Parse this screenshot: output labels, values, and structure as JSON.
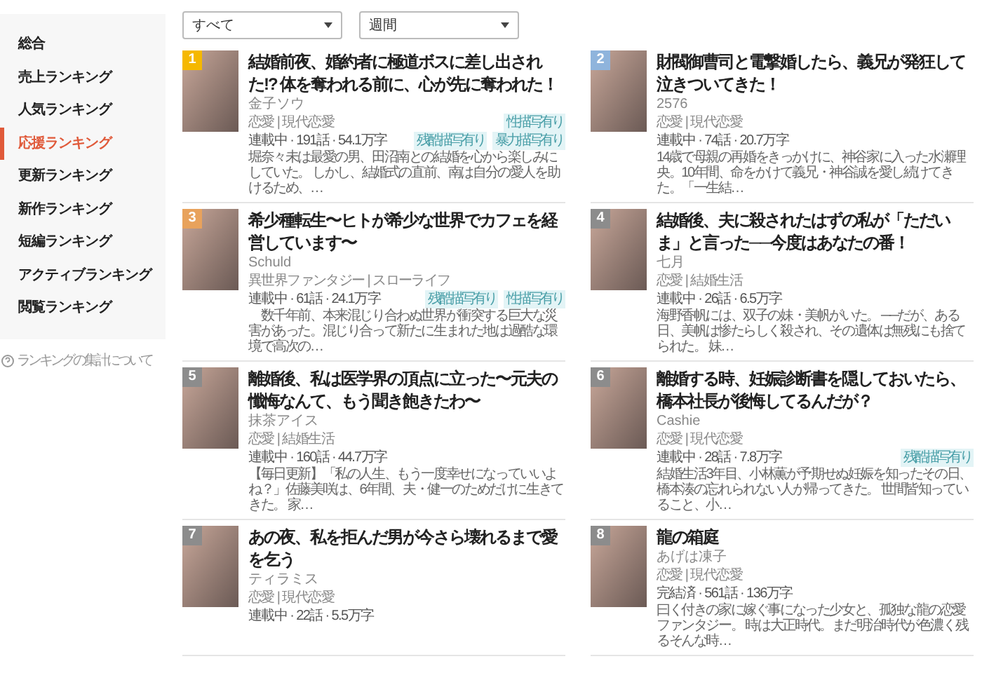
{
  "sidebar": {
    "items": [
      {
        "label": "総合",
        "selected": false
      },
      {
        "label": "売上ランキング",
        "selected": false
      },
      {
        "label": "人気ランキング",
        "selected": false
      },
      {
        "label": "応援ランキング",
        "selected": true
      },
      {
        "label": "更新ランキング",
        "selected": false
      },
      {
        "label": "新作ランキング",
        "selected": false
      },
      {
        "label": "短編ランキング",
        "selected": false
      },
      {
        "label": "アクティブランキング",
        "selected": false
      },
      {
        "label": "閲覧ランキング",
        "selected": false
      }
    ],
    "footer_link": "ランキングの集計について"
  },
  "filters": [
    {
      "value": "すべて"
    },
    {
      "value": "週間"
    }
  ],
  "books": [
    {
      "rank": "1",
      "color": "#f5b800",
      "title": "結婚前夜、婚約者に極道ボスに差し出された!? 体を奪われる前に、心が先に奪われた！",
      "author": "金子ソウ",
      "genre": "恋愛 | 現代恋愛",
      "genre_tags": [
        "性描写有り"
      ],
      "stats": "連載中 · 191話 · 54.1万字",
      "stats_tags": [
        "残酷描写有り",
        "暴力描写有り"
      ],
      "description": "堀奈々未は最愛の男、田沼南との結婚を心から楽しみにしていた。 しかし、結婚式の直前、南は自分の愛人を助けるため、…"
    },
    {
      "rank": "2",
      "color": "#8fb4dc",
      "title": "財閥御曹司と電撃婚したら、義兄が発狂して泣きついてきた！",
      "author": "2576",
      "genre": "恋愛 | 現代恋愛",
      "stats": "連載中 · 74話 · 20.7万字",
      "description": "14歳で母親の再婚をきっかけに、神谷家に入った水瀬理央。10年間、命をかけて義兄・神谷誠を愛し続けてきた。「一生結…"
    },
    {
      "rank": "3",
      "color": "#e8a25c",
      "title": "希少種転生〜ヒトが希少な世界でカフェを経営しています〜",
      "author": "Schuld",
      "genre": "異世界ファンタジー | スローライフ",
      "stats": "連載中 · 61話 · 24.1万字",
      "stats_tags": [
        "残酷描写有り",
        "性描写有り"
      ],
      "description": "　数千年前、本来混じり合わぬ世界が衝突する巨大な災害があった。混じり合って新たに生まれた地は過酷な環境で高次の…"
    },
    {
      "rank": "4",
      "color": "#8c8c8c",
      "title": "結婚後、夫に殺されたはずの私が「ただいま」と言った──今度はあなたの番！",
      "author": "七月",
      "genre": "恋愛 | 結婚生活",
      "stats": "連載中 · 26話 · 6.5万字",
      "description": "海野香帆には、双子の妹・美帆がいた。 ──だが、ある日、美帆は惨たらしく殺され、その遺体は無残にも捨てられた。 妹…"
    },
    {
      "rank": "5",
      "color": "#8c8c8c",
      "title": "離婚後、私は医学界の頂点に立った〜元夫の懺悔なんて、もう聞き飽きたわ〜",
      "author": "抹茶アイス",
      "genre": "恋愛 | 結婚生活",
      "stats": "連載中 · 160話 · 44.7万字",
      "description": "【毎日更新】「私の人生、もう一度幸せになっていいよね？」佐藤美咲は、6年間、夫・健一のためだけに生きてきた。 家…"
    },
    {
      "rank": "6",
      "color": "#8c8c8c",
      "title": "離婚する時、妊娠診断書を隠しておいたら、橋本社長が後悔してるんだが？",
      "author": "Cashie",
      "genre": "恋愛 | 現代恋愛",
      "stats": "連載中 · 28話 · 7.8万字",
      "stats_tags": [
        "残酷描写有り"
      ],
      "description": "結婚生活3年目、小林薫が予期せぬ妊娠を知ったその日、橋本湊の忘れられない人が帰ってきた。 世間皆知っていること、小…"
    },
    {
      "rank": "7",
      "color": "#8c8c8c",
      "title": "あの夜、私を拒んだ男が今さら壊れるまで愛を乞う",
      "author": "ティラミス",
      "genre": "恋愛 | 現代恋愛",
      "stats": "連載中 · 22話 · 5.5万字"
    },
    {
      "rank": "8",
      "color": "#8c8c8c",
      "title": "龍の箱庭",
      "author": "あげは凍子",
      "genre": "恋愛 | 現代恋愛",
      "stats": "完結済 · 561話 · 136万字",
      "description": "曰く付きの家に嫁ぐ事になった少女と、孤独な龍の恋愛ファンタジー。 時は大正時代。まだ明治時代が色濃く残るそんな時…"
    }
  ]
}
